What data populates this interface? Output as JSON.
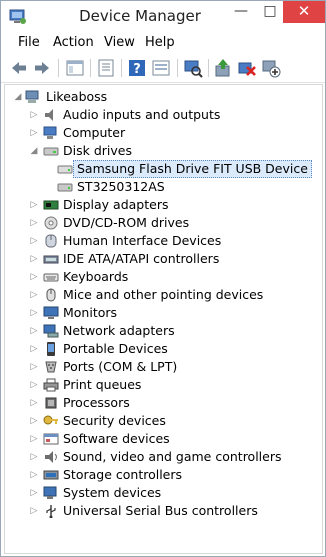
{
  "window": {
    "title": "Device Manager"
  },
  "title_buttons": {
    "minimize": "—",
    "maximize": "□",
    "close": "✕"
  },
  "menu": [
    {
      "label": "File"
    },
    {
      "label": "Action"
    },
    {
      "label": "View"
    },
    {
      "label": "Help"
    }
  ],
  "toolbar": [
    {
      "icon": "back-arrow-icon"
    },
    {
      "icon": "forward-arrow-icon"
    },
    {
      "icon": "show-hide-console-tree-icon"
    },
    {
      "icon": "properties-icon"
    },
    {
      "icon": "help-icon"
    },
    {
      "icon": "view-icon"
    },
    {
      "icon": "scan-hardware-icon"
    },
    {
      "icon": "update-driver-icon"
    },
    {
      "icon": "uninstall-icon"
    },
    {
      "icon": "add-legacy-hardware-icon"
    }
  ],
  "tree": {
    "root": "Likeaboss",
    "items": [
      {
        "label": "Audio inputs and outputs",
        "icon": "speaker-icon",
        "expanded": false
      },
      {
        "label": "Computer",
        "icon": "computer-icon",
        "expanded": false
      },
      {
        "label": "Disk drives",
        "icon": "disk-drive-icon",
        "expanded": true,
        "children": [
          {
            "label": "Samsung Flash Drive FIT USB Device",
            "icon": "usb-drive-icon",
            "selected": true
          },
          {
            "label": "ST3250312AS",
            "icon": "hard-disk-icon",
            "selected": false
          }
        ]
      },
      {
        "label": "Display adapters",
        "icon": "display-adapter-icon",
        "expanded": false
      },
      {
        "label": "DVD/CD-ROM drives",
        "icon": "dvd-drive-icon",
        "expanded": false
      },
      {
        "label": "Human Interface Devices",
        "icon": "hid-icon",
        "expanded": false
      },
      {
        "label": "IDE ATA/ATAPI controllers",
        "icon": "ide-controller-icon",
        "expanded": false
      },
      {
        "label": "Keyboards",
        "icon": "keyboard-icon",
        "expanded": false
      },
      {
        "label": "Mice and other pointing devices",
        "icon": "mouse-icon",
        "expanded": false
      },
      {
        "label": "Monitors",
        "icon": "monitor-icon",
        "expanded": false
      },
      {
        "label": "Network adapters",
        "icon": "network-adapter-icon",
        "expanded": false
      },
      {
        "label": "Portable Devices",
        "icon": "portable-device-icon",
        "expanded": false
      },
      {
        "label": "Ports (COM & LPT)",
        "icon": "port-icon",
        "expanded": false
      },
      {
        "label": "Print queues",
        "icon": "printer-icon",
        "expanded": false
      },
      {
        "label": "Processors",
        "icon": "processor-icon",
        "expanded": false
      },
      {
        "label": "Security devices",
        "icon": "security-key-icon",
        "expanded": false
      },
      {
        "label": "Software devices",
        "icon": "software-device-icon",
        "expanded": false
      },
      {
        "label": "Sound, video and game controllers",
        "icon": "sound-icon",
        "expanded": false
      },
      {
        "label": "Storage controllers",
        "icon": "storage-controller-icon",
        "expanded": false
      },
      {
        "label": "System devices",
        "icon": "system-device-icon",
        "expanded": false
      },
      {
        "label": "Universal Serial Bus controllers",
        "icon": "usb-controller-icon",
        "expanded": false
      }
    ]
  },
  "colors": {
    "close_button": "#e04343",
    "selection": "#dcebfc",
    "selection_border": "#5a86c4"
  }
}
